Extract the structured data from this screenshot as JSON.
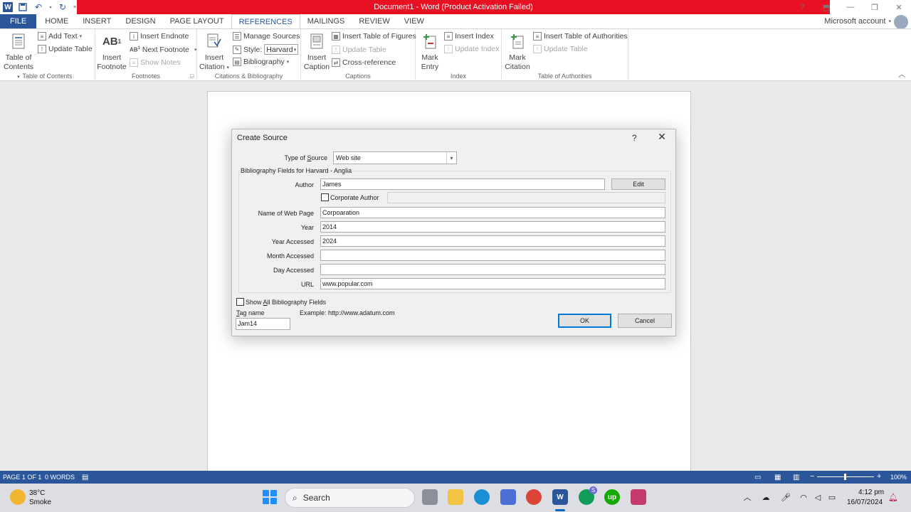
{
  "window": {
    "title": "Document1 - Word (Product Activation Failed)",
    "account": "Microsoft account",
    "help": "?",
    "minimize": "—",
    "restore": "❐",
    "close": "✕"
  },
  "colors": {
    "word_blue": "#2b579a",
    "title_alert_red": "#e81123",
    "default_button_blue": "#0078d7"
  },
  "tabs": [
    "FILE",
    "HOME",
    "INSERT",
    "DESIGN",
    "PAGE LAYOUT",
    "REFERENCES",
    "MAILINGS",
    "REVIEW",
    "VIEW"
  ],
  "active_tab": "REFERENCES",
  "ribbon": {
    "toc": {
      "big_label_1": "Table of",
      "big_label_2": "Contents",
      "add_text": "Add Text",
      "update_table": "Update Table",
      "group_label": "Table of Contents"
    },
    "footnotes": {
      "insert_footnote_1": "Insert",
      "insert_footnote_2": "Footnote",
      "insert_endnote": "Insert Endnote",
      "next_footnote": "Next Footnote",
      "show_notes": "Show Notes",
      "group_label": "Footnotes"
    },
    "citations": {
      "insert_citation_1": "Insert",
      "insert_citation_2": "Citation",
      "manage_sources": "Manage Sources",
      "style_label": "Style:",
      "style_value": "Harvard",
      "bibliography": "Bibliography",
      "group_label": "Citations & Bibliography"
    },
    "captions": {
      "insert_caption_1": "Insert",
      "insert_caption_2": "Caption",
      "insert_table_of_figures": "Insert Table of Figures",
      "update_table": "Update Table",
      "cross_reference": "Cross-reference",
      "group_label": "Captions"
    },
    "index": {
      "mark_entry_1": "Mark",
      "mark_entry_2": "Entry",
      "insert_index": "Insert Index",
      "update_index": "Update Index",
      "group_label": "Index"
    },
    "authorities": {
      "mark_citation_1": "Mark",
      "mark_citation_2": "Citation",
      "insert_table_of_authorities": "Insert Table of Authorities",
      "update_table": "Update Table",
      "group_label": "Table of Authorities"
    }
  },
  "dialog": {
    "title": "Create Source",
    "help": "?",
    "type_of_source_pre": "Type of ",
    "type_of_source_key": "S",
    "type_of_source_post": "ource",
    "type_of_source_value": "Web site",
    "fields_legend": "Bibliography Fields for Harvard - Anglia",
    "fields": {
      "author_label": "Author",
      "author_value": "James",
      "edit_button": "Edit",
      "corporate_author_label": "Corporate Author",
      "corporate_author_checked": false,
      "web_page_label": "Name of Web Page",
      "web_page_value": "Corpoaration",
      "year_label": "Year",
      "year_value": "2014",
      "year_accessed_label": "Year Accessed",
      "year_accessed_value": "2024",
      "month_accessed_label": "Month Accessed",
      "month_accessed_value": "",
      "day_accessed_label": "Day Accessed",
      "day_accessed_value": "",
      "url_label": "URL",
      "url_value": "www.popular.com"
    },
    "show_all_pre": "Show ",
    "show_all_key": "A",
    "show_all_post": "ll Bibliography Fields",
    "show_all_checked": false,
    "tag_name_key": "T",
    "tag_name_post": "ag name",
    "tag_name_value": "Jam14",
    "example": "Example: http://www.adatum.com",
    "ok": "OK",
    "cancel": "Cancel"
  },
  "statusbar": {
    "page": "PAGE 1 OF 1",
    "words": "0 WORDS",
    "zoom": "100%",
    "zoom_percent": 100
  },
  "taskbar": {
    "temperature": "38°C",
    "weather": "Smoke",
    "search": "Search",
    "time": "4:12 pm",
    "date": "16/07/2024",
    "chrome_badge": "S"
  }
}
